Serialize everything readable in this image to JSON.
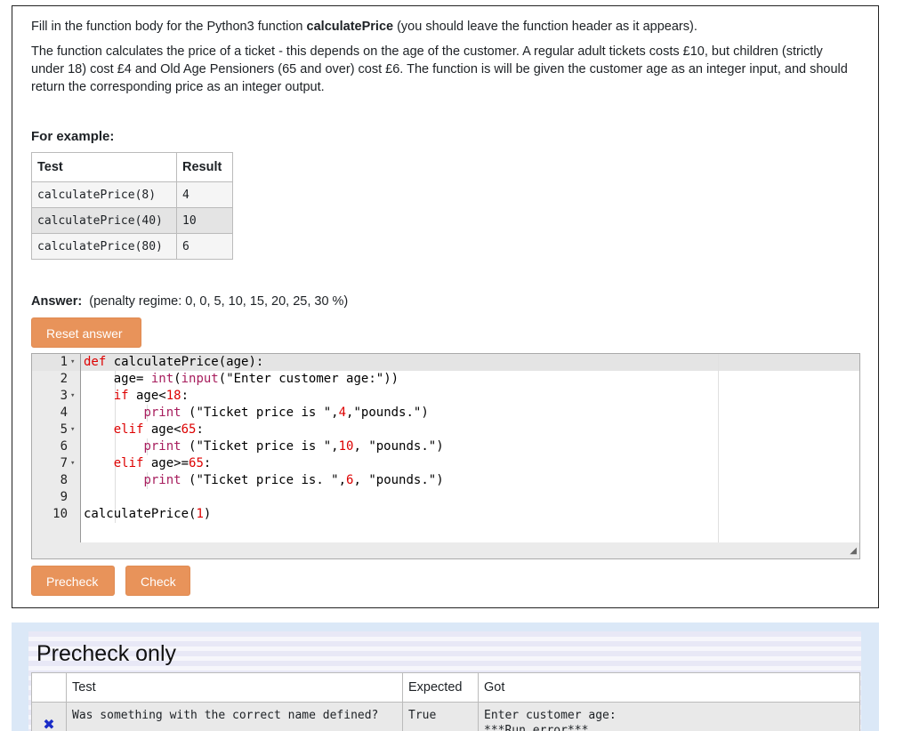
{
  "question": {
    "intro_pre": "Fill in the function body for the Python3 function ",
    "intro_func": "calculatePrice",
    "intro_post": " (you should leave the function header as it appears).",
    "description": "The function calculates the price of a ticket - this depends on the age of the customer.  A regular adult tickets costs £10, but children (strictly under 18) cost £4 and Old Age Pensioners (65 and over) cost £6.  The function is will be given the customer age as an integer input, and should return the corresponding price as an integer output.",
    "for_example": "For example:",
    "example_table": {
      "headers": [
        "Test",
        "Result"
      ],
      "rows": [
        [
          "calculatePrice(8)",
          "4"
        ],
        [
          "calculatePrice(40)",
          "10"
        ],
        [
          "calculatePrice(80)",
          "6"
        ]
      ]
    },
    "answer_label": "Answer:",
    "penalty": "(penalty regime: 0, 0, 5, 10, 15, 20, 25, 30 %)",
    "reset_button": "Reset answer",
    "precheck_button": "Precheck",
    "check_button": "Check"
  },
  "editor": {
    "line_numbers": [
      "1",
      "2",
      "3",
      "4",
      "5",
      "6",
      "7",
      "8",
      "9",
      "10"
    ],
    "fold_markers": [
      "▾",
      "",
      "▾",
      "",
      "▾",
      "",
      "▾",
      "",
      "",
      ""
    ],
    "lines": [
      "def calculatePrice(age):",
      "    age= int(input(\"Enter customer age:\"))",
      "    if age<18:",
      "        print (\"Ticket price is \",4,\"pounds.\")",
      "    elif age<65:",
      "        print (\"Ticket price is \",10, \"pounds.\")",
      "    elif age>=65:",
      "        print (\"Ticket price is. \",6, \"pounds.\")",
      "",
      "calculatePrice(1)"
    ]
  },
  "results": {
    "title": "Precheck only",
    "headers": [
      "",
      "Test",
      "Expected",
      "Got"
    ],
    "row": {
      "status_icon": "cross-icon",
      "status_symbol": "✖",
      "test": "Was something with the correct name defined?",
      "expected": "True",
      "got_line1": "Enter customer age:",
      "got_line2": "***Run error***"
    }
  },
  "colors": {
    "button": "#e8935a",
    "result_panel": "#dbe8f7",
    "keyword": "#a71d5d",
    "number": "#dd0000",
    "fail_mark": "#1a2cc7"
  }
}
